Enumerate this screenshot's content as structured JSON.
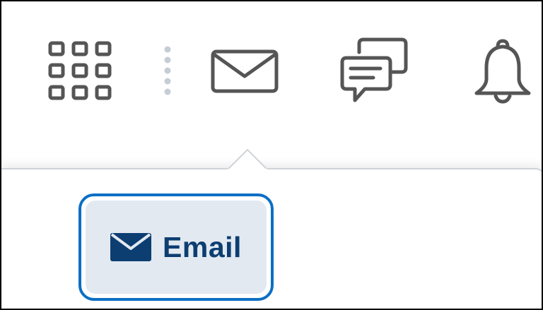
{
  "topbar": {
    "icons": {
      "waffle": "waffle-icon",
      "divider": "vertical-dots-divider",
      "mail": "envelope-icon",
      "chat": "chat-bubbles-icon",
      "bell": "bell-icon"
    },
    "colors": {
      "icon_stroke": "#555555",
      "divider_dots": "#c5cdd6"
    }
  },
  "dropdown": {
    "email_button": {
      "label": "Email",
      "icon": "envelope-icon"
    },
    "colors": {
      "focus_ring": "#0b6fc4",
      "button_fill": "#e3e9f1",
      "label_text": "#0d3e72"
    }
  }
}
